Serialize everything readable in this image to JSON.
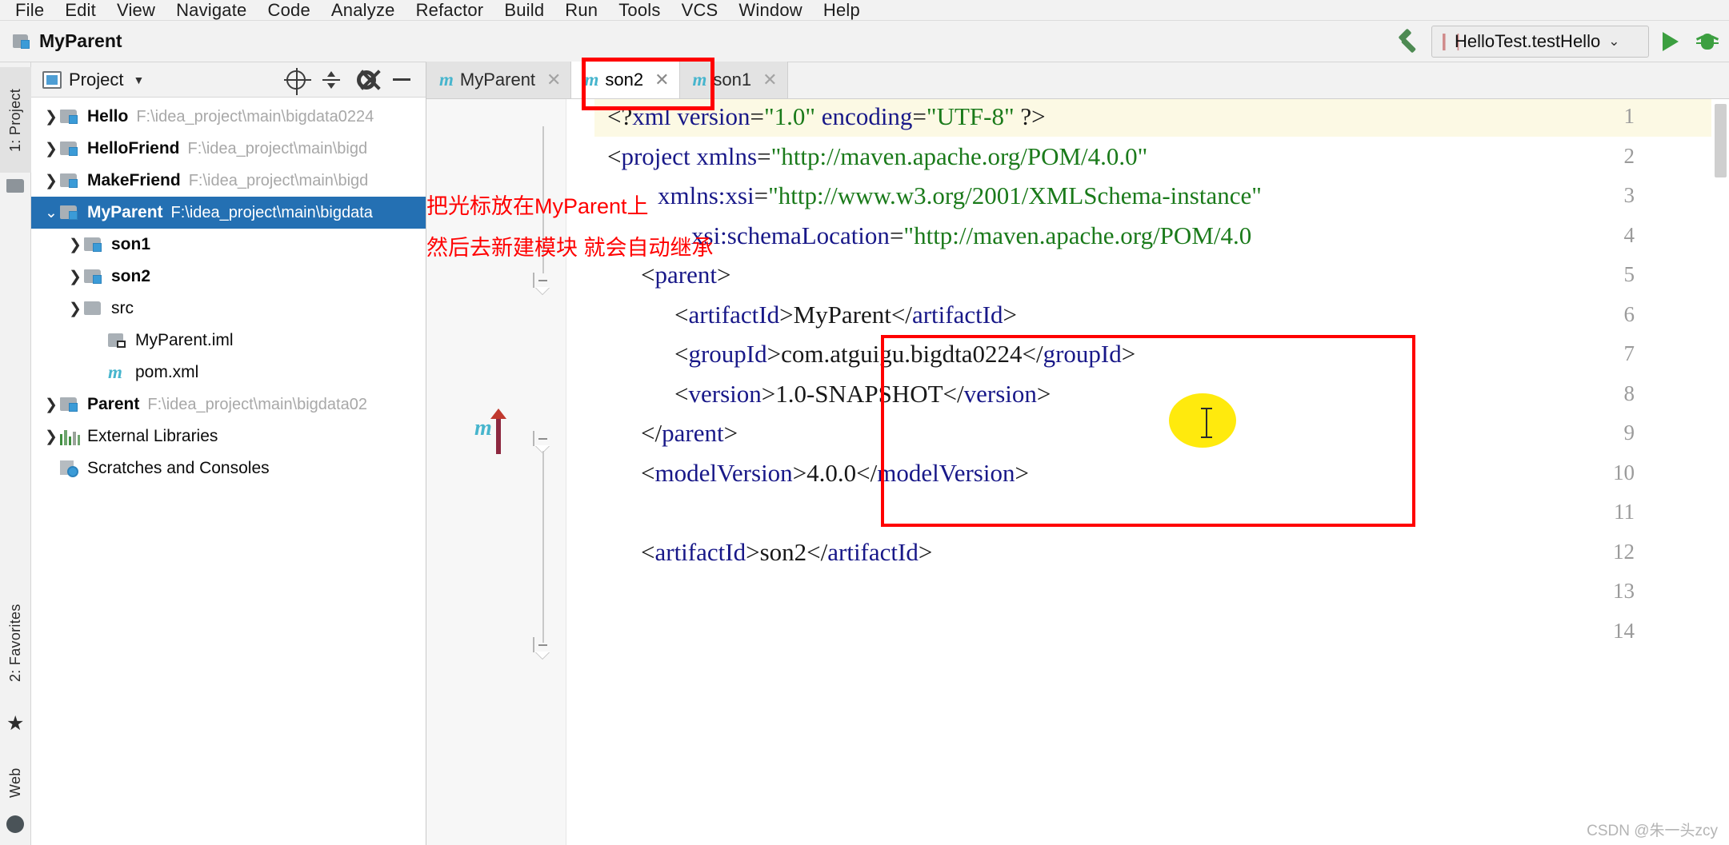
{
  "menu": {
    "items": [
      "File",
      "Edit",
      "View",
      "Navigate",
      "Code",
      "Analyze",
      "Refactor",
      "Build",
      "Run",
      "Tools",
      "VCS",
      "Window",
      "Help"
    ]
  },
  "navbar": {
    "project_name": "MyParent",
    "project_icon": "module-folder-icon",
    "hammer_icon": "build-hammer-icon",
    "run_config": "HelloTest.testHello",
    "run_config_chevron": "⌄",
    "run_icon": "run-play-icon",
    "debug_icon": "debug-bug-icon"
  },
  "left_strip": {
    "tabs": [
      {
        "label": "1: Project",
        "selected": true
      },
      {
        "label": "2: Favorites",
        "selected": false
      },
      {
        "label": "Web",
        "selected": false
      }
    ]
  },
  "project_panel": {
    "title": "Project",
    "chevron": "▼",
    "actions": [
      "locate-target-icon",
      "collapse-all-icon",
      "settings-gear-icon",
      "hide-minus-icon"
    ],
    "tree": [
      {
        "name": "Hello",
        "path": "F:\\idea_project\\main\\bigdata0224",
        "arrow": "collapsed",
        "icon": "module-folder-icon",
        "indent": 0,
        "selected": false,
        "bold": true
      },
      {
        "name": "HelloFriend",
        "path": "F:\\idea_project\\main\\bigd",
        "arrow": "collapsed",
        "icon": "module-folder-icon",
        "indent": 0,
        "selected": false,
        "bold": true
      },
      {
        "name": "MakeFriend",
        "path": "F:\\idea_project\\main\\bigd",
        "arrow": "collapsed",
        "icon": "module-folder-icon",
        "indent": 0,
        "selected": false,
        "bold": true
      },
      {
        "name": "MyParent",
        "path": "F:\\idea_project\\main\\bigdata",
        "arrow": "expanded",
        "icon": "module-folder-icon",
        "indent": 0,
        "selected": true,
        "bold": true
      },
      {
        "name": "son1",
        "path": "",
        "arrow": "collapsed",
        "icon": "module-folder-icon",
        "indent": 1,
        "selected": false,
        "bold": true
      },
      {
        "name": "son2",
        "path": "",
        "arrow": "collapsed",
        "icon": "module-folder-icon",
        "indent": 1,
        "selected": false,
        "bold": true
      },
      {
        "name": "src",
        "path": "",
        "arrow": "collapsed",
        "icon": "plain-folder-icon",
        "indent": 1,
        "selected": false,
        "bold": false
      },
      {
        "name": "MyParent.iml",
        "path": "",
        "arrow": "none",
        "icon": "iml-file-icon",
        "indent": 2,
        "selected": false,
        "bold": false
      },
      {
        "name": "pom.xml",
        "path": "",
        "arrow": "none",
        "icon": "maven-pom-icon",
        "indent": 2,
        "selected": false,
        "bold": false
      },
      {
        "name": "Parent",
        "path": "F:\\idea_project\\main\\bigdata02",
        "arrow": "collapsed",
        "icon": "module-folder-icon",
        "indent": 0,
        "selected": false,
        "bold": true
      },
      {
        "name": "External Libraries",
        "path": "",
        "arrow": "collapsed",
        "icon": "libraries-icon",
        "indent": 0,
        "selected": false,
        "bold": false
      },
      {
        "name": "Scratches and Consoles",
        "path": "",
        "arrow": "none",
        "icon": "scratches-icon",
        "indent": 0,
        "selected": false,
        "bold": false
      }
    ]
  },
  "editor_tabs": [
    {
      "label": "MyParent",
      "icon": "maven-m-icon",
      "close": "✕",
      "active": false
    },
    {
      "label": "son2",
      "icon": "maven-m-icon",
      "close": "✕",
      "active": true
    },
    {
      "label": "son1",
      "icon": "maven-m-icon",
      "close": "✕",
      "active": false
    }
  ],
  "editor": {
    "line_numbers": [
      "1",
      "2",
      "3",
      "4",
      "5",
      "6",
      "7",
      "8",
      "9",
      "10",
      "11",
      "12",
      "13",
      "14"
    ],
    "lines": [
      {
        "n": "1",
        "text": "<?xml version=\"1.0\" encoding=\"UTF-8\" ?>"
      },
      {
        "n": "2",
        "text": "<project xmlns=\"http://maven.apache.org/POM/4.0.0\""
      },
      {
        "n": "3",
        "text": "xmlns:xsi=\"http://www.w3.org/2001/XMLSchema-instance\""
      },
      {
        "n": "4",
        "text": "xsi:schemaLocation=\"http://maven.apache.org/POM/4.0"
      },
      {
        "n": "5",
        "text": "<parent>"
      },
      {
        "n": "6",
        "text": "<artifactId>MyParent</artifactId>"
      },
      {
        "n": "7",
        "text": "<groupId>com.atguigu.bigdta0224</groupId>"
      },
      {
        "n": "8",
        "text": "<version>1.0-SNAPSHOT</version>"
      },
      {
        "n": "9",
        "text": "</parent>"
      },
      {
        "n": "10",
        "text": "<modelVersion>4.0.0</modelVersion>"
      },
      {
        "n": "11",
        "text": ""
      },
      {
        "n": "12",
        "text": "<artifactId>son2</artifactId>"
      },
      {
        "n": "13",
        "text": ""
      },
      {
        "n": "14",
        "text": ""
      }
    ]
  },
  "annotations": {
    "line1": "把光标放在MyParent上",
    "line2": "然后去新建模块 就会自动继承",
    "color": "#ff0000"
  },
  "watermark": "CSDN @朱一头zcy"
}
